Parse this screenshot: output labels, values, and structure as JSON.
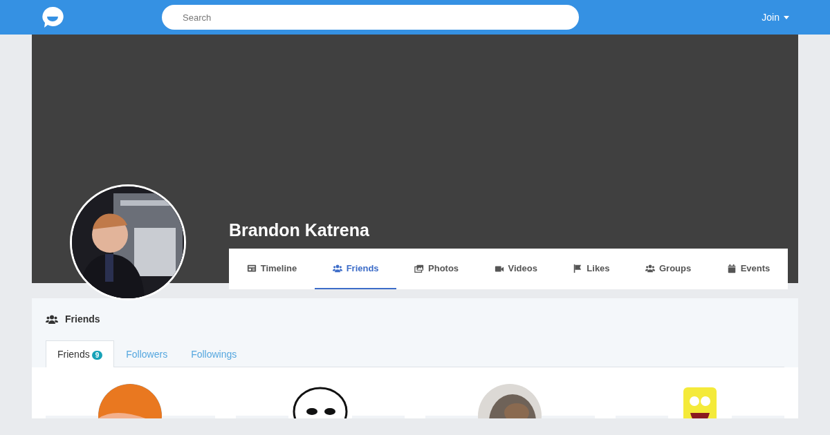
{
  "navbar": {
    "search": {
      "placeholder": "Search"
    },
    "join_menu": {
      "label": "Join"
    }
  },
  "profile": {
    "name": "Brandon Katrena"
  },
  "profile_tabs": [
    {
      "label": "Timeline",
      "selected": false
    },
    {
      "label": "Friends",
      "selected": true
    },
    {
      "label": "Photos",
      "selected": false
    },
    {
      "label": "Videos",
      "selected": false
    },
    {
      "label": "Likes",
      "selected": false
    },
    {
      "label": "Groups",
      "selected": false
    },
    {
      "label": "Events",
      "selected": false
    }
  ],
  "friends_section": {
    "title": "Friends",
    "tabs": [
      {
        "label": "Friends",
        "count": "9",
        "selected": true
      },
      {
        "label": "Followers",
        "selected": false
      },
      {
        "label": "Followings",
        "selected": false
      }
    ]
  }
}
